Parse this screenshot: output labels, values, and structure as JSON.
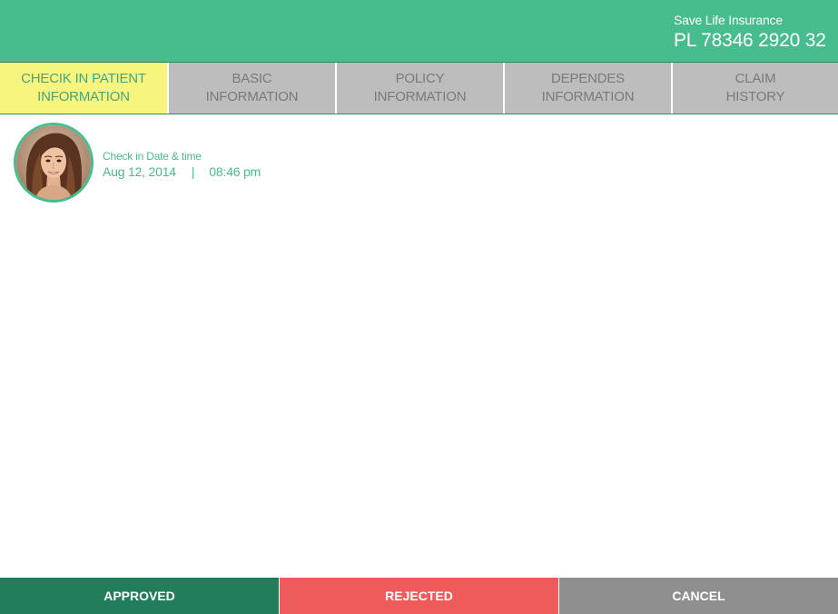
{
  "header": {
    "company": "Save Life Insurance",
    "policy_number": "PL 78346 2920 32"
  },
  "tabs": [
    {
      "line1": "CHECIK IN PATIENT",
      "line2": "INFORMATION",
      "active": true
    },
    {
      "line1": "BASIC",
      "line2": "INFORMATION",
      "active": false
    },
    {
      "line1": "POLICY",
      "line2": "INFORMATION",
      "active": false
    },
    {
      "line1": "DEPENDES",
      "line2": "INFORMATION",
      "active": false
    },
    {
      "line1": "CLAIM",
      "line2": "HISTORY",
      "active": false
    }
  ],
  "patient": {
    "avatar_icon": "patient-photo",
    "checkin_label": "Check in Date & time",
    "checkin_date": "Aug 12, 2014",
    "separator": "|",
    "checkin_time": "08:46 pm"
  },
  "footer": {
    "approved_label": "APPROVED",
    "rejected_label": "REJECTED",
    "cancel_label": "CANCEL"
  },
  "colors": {
    "brand_green": "#47bc8d",
    "approve": "#227d5b",
    "reject": "#ef5a5b",
    "cancel": "#8f8f8f",
    "active_tab": "#f8f57e",
    "inactive_tab": "#bdbdbd"
  }
}
